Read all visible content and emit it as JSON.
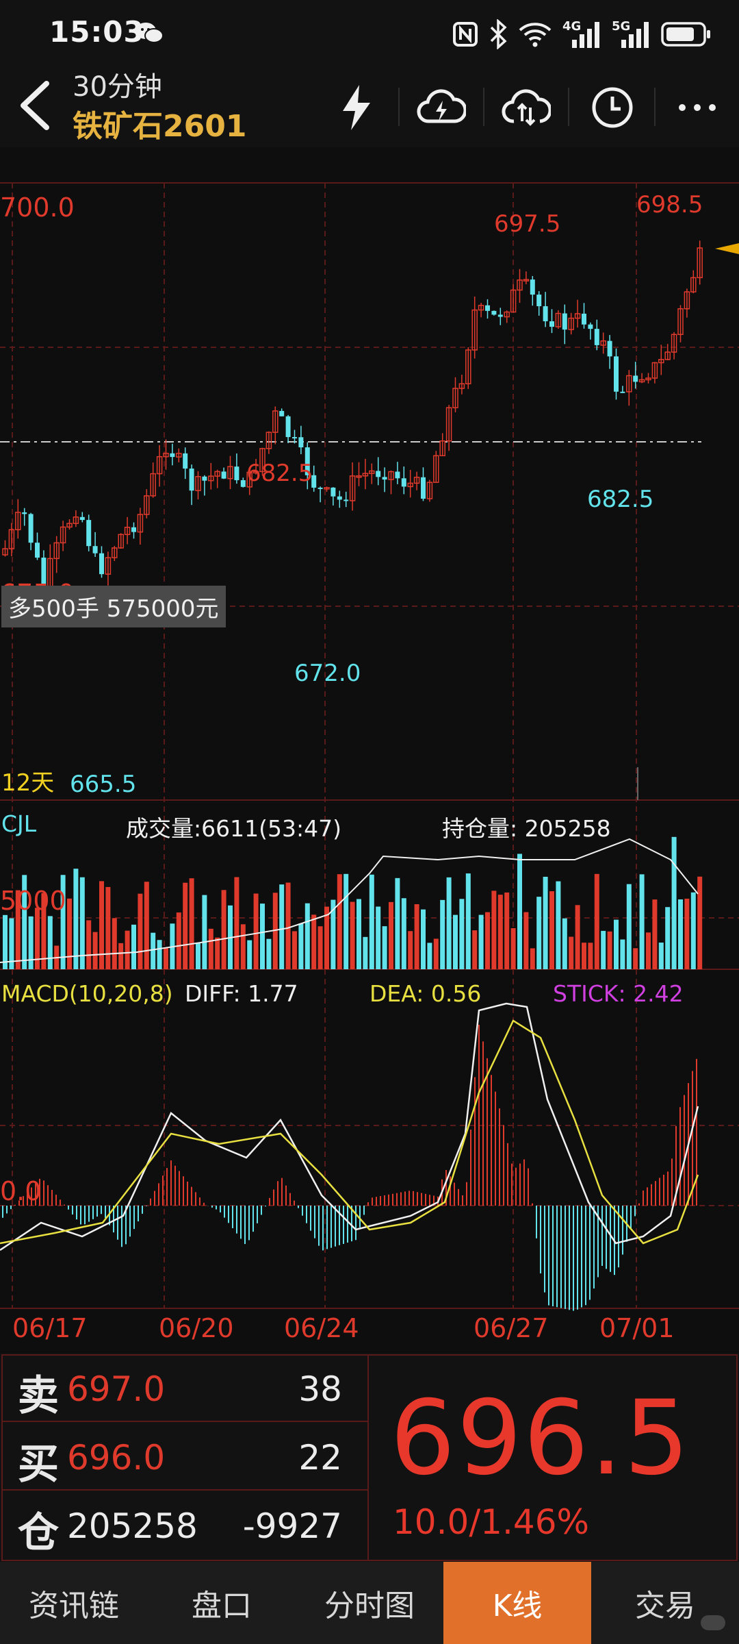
{
  "status": {
    "time": "15:03",
    "net_4g": "4G",
    "net_5g": "5G"
  },
  "header": {
    "period": "30分钟",
    "contract": "铁矿石2601"
  },
  "toolbar": {
    "icons": [
      "flash-icon",
      "cloud-flash-icon",
      "cloud-sync-icon",
      "clock-icon",
      "more-icon"
    ]
  },
  "chart": {
    "price_700": "700.0",
    "price_675": "675.0",
    "high_label": "698.5",
    "peak_label": "697.5",
    "mid_high_label": "682.5",
    "low_682": "682.5",
    "low_672": "672.0",
    "low_665": "665.5",
    "order_box": "多500手  575000元",
    "days": "12天",
    "volume": {
      "title": "CJL",
      "vol_text": "成交量:6611(53:47)",
      "oi_text": "持仓量: 205258",
      "scale": "5000"
    },
    "macd": {
      "title": "MACD(10,20,8)",
      "diff": "DIFF: 1.77",
      "dea": "DEA: 0.56",
      "stick": "STICK: 2.42",
      "zero": "0.0"
    },
    "dates": [
      "06/17",
      "06/20",
      "06/24",
      "06/27",
      "07/01"
    ]
  },
  "chart_data": {
    "type": "candlestick",
    "annotations": [
      "698.5",
      "697.5",
      "682.5",
      "682.5",
      "672.0",
      "665.5"
    ],
    "levels": [
      700.0,
      675.0
    ],
    "last": 696.5
  },
  "quote": {
    "sell_char": "卖",
    "sell_price": "697.0",
    "sell_qty": "38",
    "buy_char": "买",
    "buy_price": "696.0",
    "buy_qty": "22",
    "oi_char": "仓",
    "oi_value": "205258",
    "oi_change": "-9927",
    "last_price": "696.5",
    "change": "10.0/1.46%"
  },
  "nav": [
    "资讯链",
    "盘口",
    "分时图",
    "K线",
    "交易"
  ],
  "colors": {
    "up": "#e03a2c",
    "down": "#62e3ec",
    "accent": "#e0702a",
    "gold": "#e6b240"
  }
}
